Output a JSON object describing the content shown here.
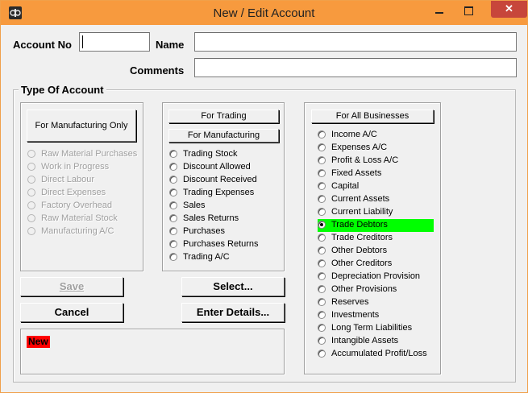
{
  "window": {
    "title": "New / Edit Account"
  },
  "form": {
    "account_no_label": "Account No",
    "account_no_value": "",
    "name_label": "Name",
    "name_value": "",
    "comments_label": "Comments",
    "comments_value": ""
  },
  "group": {
    "title": "Type Of Account"
  },
  "manufacturing": {
    "header_button": "For Manufacturing Only",
    "items": [
      "Raw Material Purchases",
      "Work in Progress",
      "Direct Labour",
      "Direct Expenses",
      "Factory Overhead",
      "Raw Material Stock",
      "Manufacturing A/C"
    ]
  },
  "trading": {
    "header_button_1": "For Trading",
    "header_button_2": "For Manufacturing",
    "items": [
      "Trading Stock",
      "Discount Allowed",
      "Discount Received",
      "Trading Expenses",
      "Sales",
      "Sales Returns",
      "Purchases",
      "Purchases Returns",
      "Trading A/C"
    ]
  },
  "all_businesses": {
    "header_button": "For All Businesses",
    "items": [
      "Income A/C",
      "Expenses A/C",
      "Profit & Loss A/C",
      "Fixed Assets",
      "Capital",
      "Current Assets",
      "Current Liability",
      "Trade Debtors",
      "Trade Creditors",
      "Other Debtors",
      "Other Creditors",
      "Depreciation Provision",
      "Other Provisions",
      "Reserves",
      "Investments",
      "Long Term Liabilities",
      "Intangible Assets",
      "Accumulated Profit/Loss"
    ],
    "selected": "Trade Debtors"
  },
  "buttons": {
    "save": "Save",
    "cancel": "Cancel",
    "select": "Select...",
    "enter_details": "Enter Details..."
  },
  "status": {
    "mode": "New"
  },
  "colors": {
    "titlebar": "#f79a3e",
    "selected_highlight": "#00ff00",
    "new_badge": "#ff0000",
    "close_button": "#c7463b"
  }
}
